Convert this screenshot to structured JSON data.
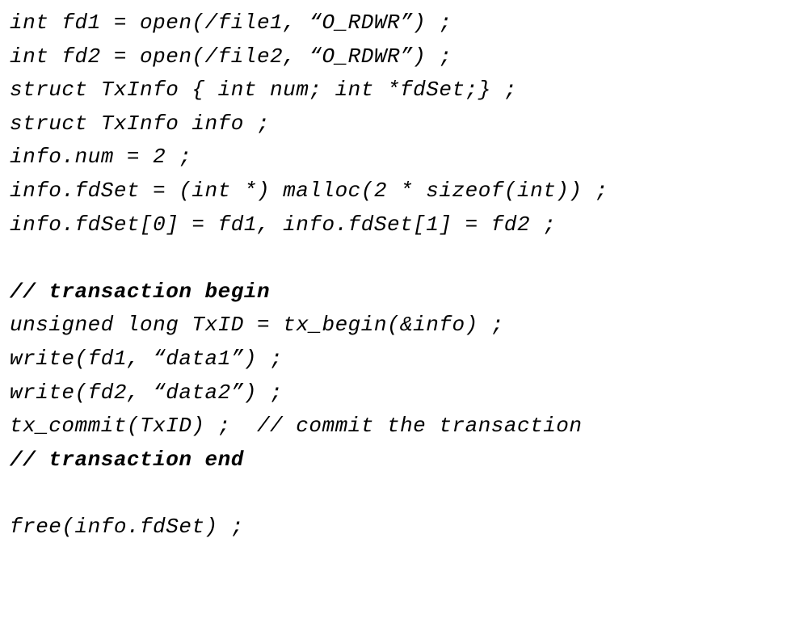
{
  "code": {
    "line1": "int fd1 = open(/file1, “O_RDWR”) ;",
    "line2": "int fd2 = open(/file2, “O_RDWR”) ;",
    "line3": "struct TxInfo { int num; int *fdSet;} ;",
    "line4": "struct TxInfo info ;",
    "line5": "info.num = 2 ;",
    "line6": "info.fdSet = (int *) malloc(2 * sizeof(int)) ;",
    "line7": "info.fdSet[0] = fd1, info.fdSet[1] = fd2 ;",
    "line8": "",
    "line9": "// transaction begin",
    "line10": "unsigned long TxID = tx_begin(&info) ;",
    "line11": "write(fd1, “data1”) ;",
    "line12": "write(fd2, “data2”) ;",
    "line13": "tx_commit(TxID) ;  // commit the transaction",
    "line14": "// transaction end",
    "line15": "",
    "line16": "free(info.fdSet) ;"
  }
}
